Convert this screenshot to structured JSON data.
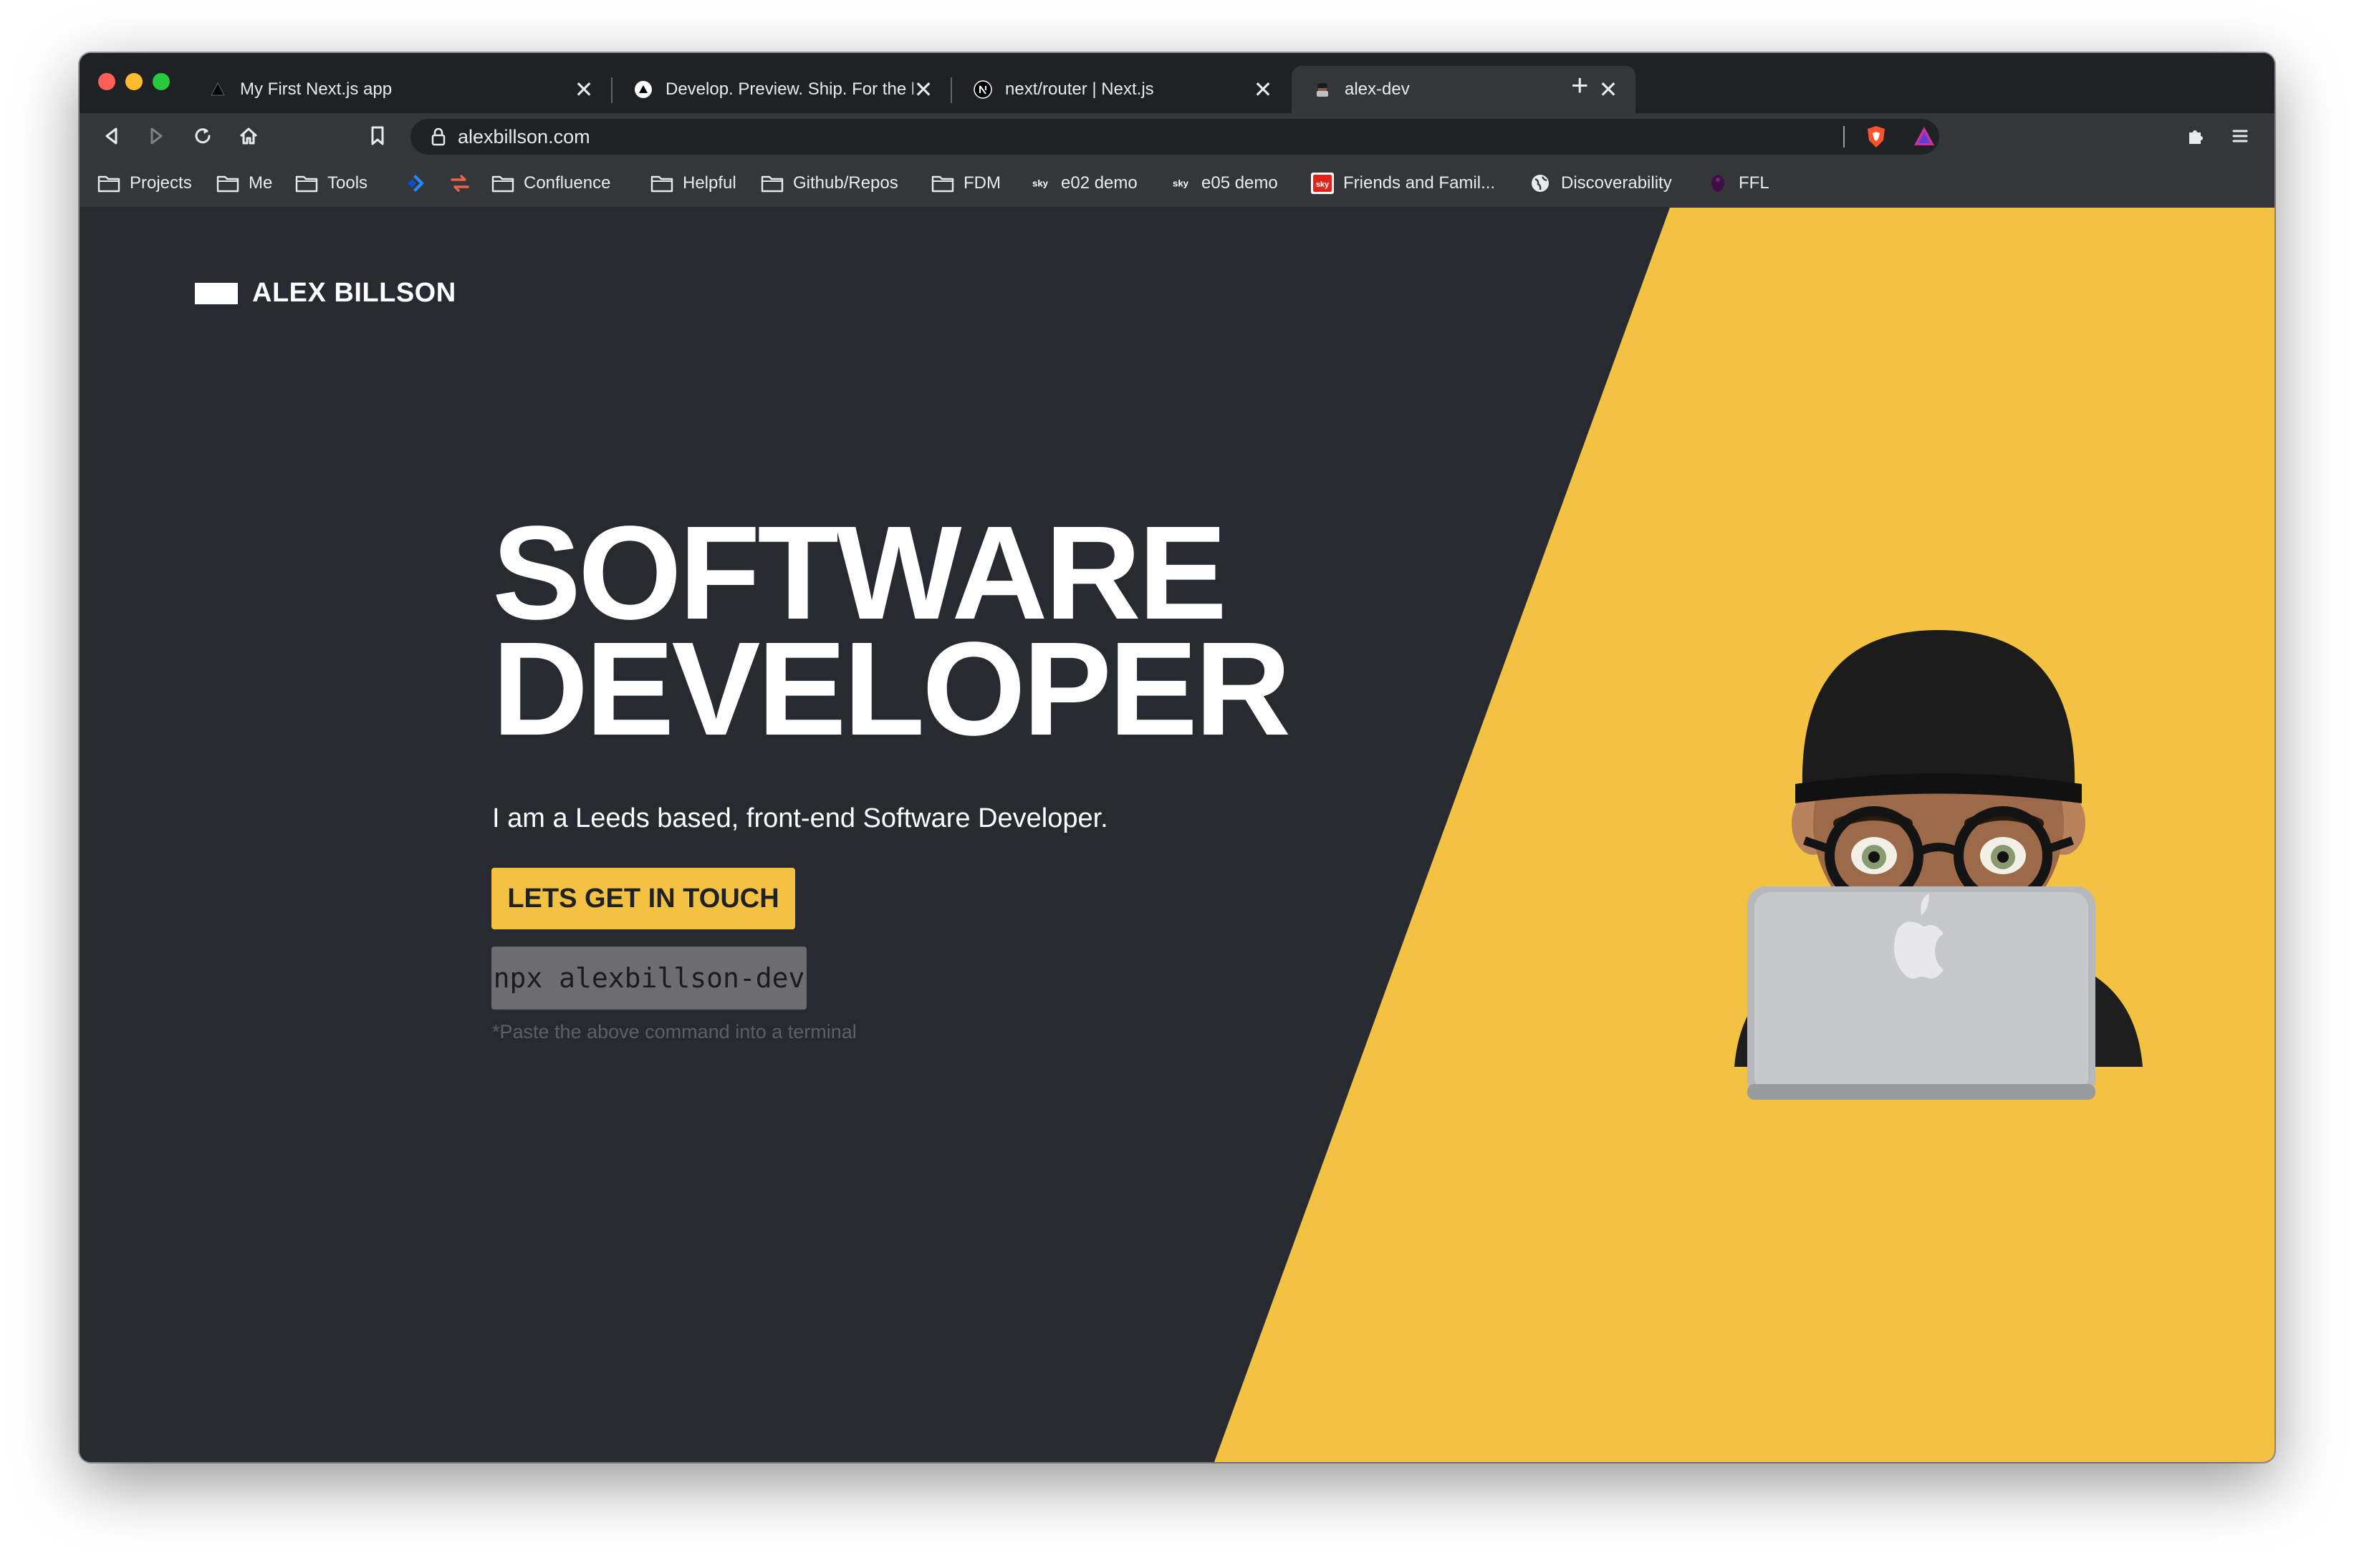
{
  "browser": {
    "tabs": [
      {
        "title": "My First Next.js app",
        "icon": "triangle-icon",
        "active": false
      },
      {
        "title": "Develop. Preview. Ship. For the be",
        "icon": "vercel-icon",
        "active": false
      },
      {
        "title": "next/router | Next.js",
        "icon": "nextjs-icon",
        "active": false
      },
      {
        "title": "alex-dev",
        "icon": "avatar-favicon",
        "active": true
      }
    ],
    "close_glyph": "✕",
    "new_tab_glyph": "+",
    "url": "alexbillson.com",
    "bookmarks": [
      {
        "label": "Projects",
        "icon": "folder-icon"
      },
      {
        "label": "Me",
        "icon": "folder-icon"
      },
      {
        "label": "Tools",
        "icon": "folder-icon"
      },
      {
        "label": "",
        "icon": "jira-icon"
      },
      {
        "label": "",
        "icon": "swap-arrows-icon"
      },
      {
        "label": "Confluence",
        "icon": "folder-icon"
      },
      {
        "label": "Helpful",
        "icon": "folder-icon"
      },
      {
        "label": "Github/Repos",
        "icon": "folder-icon"
      },
      {
        "label": "FDM",
        "icon": "folder-icon"
      },
      {
        "label": "e02 demo",
        "icon": "sky-icon"
      },
      {
        "label": "e05 demo",
        "icon": "sky-icon"
      },
      {
        "label": "Friends and Famil...",
        "icon": "sky-red-icon"
      },
      {
        "label": "Discoverability",
        "icon": "globe-icon"
      },
      {
        "label": "FFL",
        "icon": "premier-league-icon"
      }
    ]
  },
  "site": {
    "brand": "ALEX BILLSON",
    "title_line1": "SOFTWARE",
    "title_line2": "DEVELOPER",
    "tagline": "I am a Leeds based, front-end Software Developer.",
    "cta_label": "LETS GET IN TOUCH",
    "command": "npx alexbillson-dev",
    "hint": "*Paste the above command into a terminal",
    "avatar": "memoji-avatar-with-laptop"
  },
  "colors": {
    "page_dark": "#282a32",
    "accent_yellow": "#f4c242",
    "command_bg": "#6d6d6f",
    "chrome_dark": "#202124",
    "chrome_toolbar": "#35363a"
  }
}
